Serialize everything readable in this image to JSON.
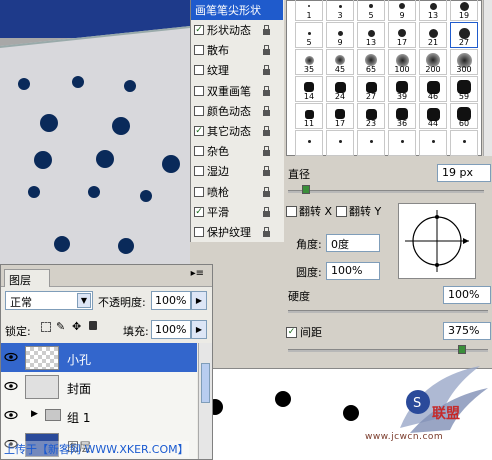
{
  "brush_settings": {
    "header": "画笔笔尖形状",
    "items": [
      {
        "label": "形状动态",
        "checked": true
      },
      {
        "label": "散布",
        "checked": false
      },
      {
        "label": "纹理",
        "checked": false
      },
      {
        "label": "双重画笔",
        "checked": false
      },
      {
        "label": "颜色动态",
        "checked": false
      },
      {
        "label": "其它动态",
        "checked": true
      },
      {
        "label": "杂色",
        "checked": false
      },
      {
        "label": "湿边",
        "checked": false
      },
      {
        "label": "喷枪",
        "checked": false
      },
      {
        "label": "平滑",
        "checked": true
      },
      {
        "label": "保护纹理",
        "checked": false
      }
    ]
  },
  "brush_tips": {
    "rows": [
      [
        "1",
        "3",
        "5",
        "9",
        "13",
        "19"
      ],
      [
        "5",
        "9",
        "13",
        "17",
        "21",
        "27"
      ],
      [
        "35",
        "45",
        "65",
        "100",
        "200",
        "300"
      ],
      [
        "14",
        "24",
        "27",
        "39",
        "46",
        "59"
      ],
      [
        "11",
        "17",
        "23",
        "36",
        "44",
        "60"
      ],
      [
        "",
        "",
        "",
        "",
        "",
        ""
      ]
    ]
  },
  "diameter": {
    "label": "直径",
    "value": "19 px"
  },
  "flip_x": {
    "label": "翻转 X",
    "checked": false
  },
  "flip_y": {
    "label": "翻转 Y",
    "checked": false
  },
  "angle": {
    "label": "角度:",
    "value": "0度"
  },
  "roundness": {
    "label": "圆度:",
    "value": "100%"
  },
  "hardness": {
    "label": "硬度",
    "value": "100%"
  },
  "spacing": {
    "label": "间距",
    "value": "375%",
    "checked": true
  },
  "layers_panel": {
    "tab": "图层",
    "blend_mode": "正常",
    "opacity_label": "不透明度:",
    "opacity_value": "100%",
    "lock_label": "锁定:",
    "fill_label": "填充:",
    "fill_value": "100%",
    "layers": [
      {
        "name": "小孔",
        "selected": true
      },
      {
        "name": "封面",
        "selected": false
      },
      {
        "name": "组 1",
        "selected": false
      },
      {
        "name": "图层",
        "selected": false
      }
    ]
  },
  "watermark": {
    "upload_text": "上传于【新客网 WWW.XKER.COM】",
    "site_url": "www.jcwcn.com"
  }
}
